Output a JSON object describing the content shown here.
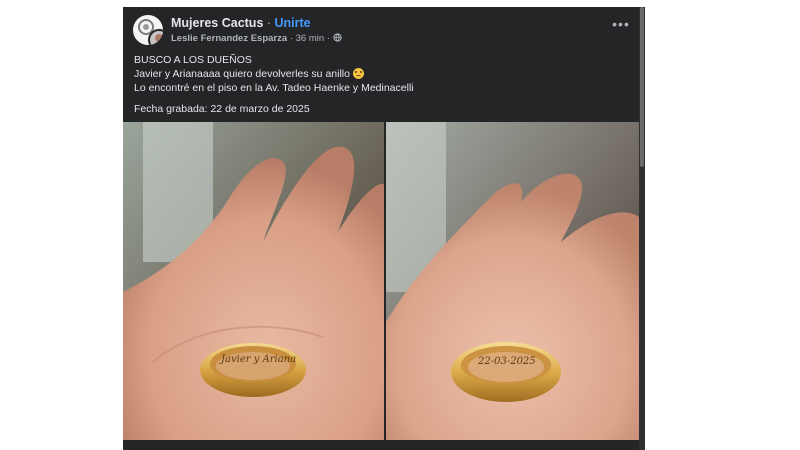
{
  "post": {
    "group_name": "Mujeres Cactus",
    "separator": " · ",
    "join_label": "Unirte",
    "author": "Leslie Fernandez Esparza",
    "time": "36 min",
    "more_label": "•••",
    "lines": [
      "BUSCO A LOS DUEÑOS",
      "Javier y Arianaaaa quiero devolverles su anillo",
      "Lo encontré en el piso en la Av. Tadeo Haenke y Medinacelli"
    ],
    "date_line": "Fecha grabada: 22 de marzo de 2025",
    "photos": [
      {
        "engraving": "Javier y Ariana"
      },
      {
        "engraving": "22-03-2025"
      }
    ]
  },
  "colors": {
    "card_bg": "#242526",
    "link_blue": "#4599ff",
    "text_primary": "#e4e6eb",
    "text_secondary": "#b0b3b8"
  },
  "icons": {
    "more": "more-options-icon",
    "privacy": "globe-icon",
    "emoji": "pleading-face-emoji"
  }
}
